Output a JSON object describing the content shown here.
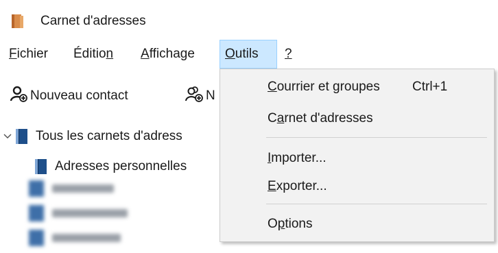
{
  "window": {
    "title": "Carnet d'adresses"
  },
  "menubar": {
    "items": [
      {
        "pre": "",
        "acc": "F",
        "post": "ichier"
      },
      {
        "pre": "Éditio",
        "acc": "n",
        "post": ""
      },
      {
        "pre": "",
        "acc": "A",
        "post": "ffichage"
      },
      {
        "pre": "",
        "acc": "O",
        "post": "utils"
      },
      {
        "pre": "",
        "acc": "?",
        "post": ""
      }
    ],
    "active_index": 3
  },
  "toolbar": {
    "new_contact_label": "Nouveau contact",
    "second_button_partial": "N"
  },
  "tree": {
    "all_books_label": "Tous les carnets d'adress",
    "personal_label": "Adresses personnelles"
  },
  "dropdown": {
    "items": [
      {
        "pre": "",
        "acc": "C",
        "post": "ourrier et groupes",
        "shortcut": "Ctrl+1"
      },
      {
        "pre": "C",
        "acc": "a",
        "post": "rnet d'adresses",
        "shortcut": ""
      },
      {
        "pre": "",
        "acc": "I",
        "post": "mporter...",
        "shortcut": ""
      },
      {
        "pre": "",
        "acc": "E",
        "post": "xporter...",
        "shortcut": ""
      },
      {
        "pre": "O",
        "acc": "p",
        "post": "tions",
        "shortcut": ""
      }
    ]
  },
  "icons": {
    "title": "book-icon",
    "toolbar_new_contact": "add-user-icon",
    "toolbar_new_list": "add-group-icon",
    "tree_expand": "chevron-down-icon",
    "tree_book": "address-book-icon"
  },
  "colors": {
    "menu_active_bg": "#cce8ff",
    "menu_active_border": "#99d1ff",
    "dropdown_bg": "#f2f2f2",
    "book_blue": "#1e4f8a"
  }
}
